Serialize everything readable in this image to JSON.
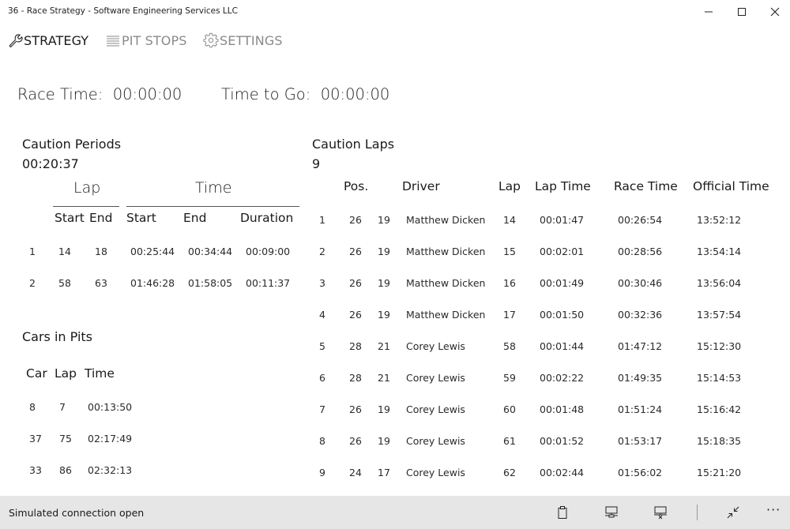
{
  "app": {
    "title": "36 - Race Strategy - Software Engineering Services LLC"
  },
  "nav": {
    "strategy": "STRATEGY",
    "pit_stops": "PIT STOPS",
    "settings": "SETTINGS"
  },
  "race": {
    "race_time_label": "Race Time:",
    "race_time_value": "00:00:00",
    "time_to_go_label": "Time to Go:",
    "time_to_go_value": "00:00:00"
  },
  "caution_periods": {
    "title": "Caution Periods",
    "total": "00:20:37",
    "group_lap": "Lap",
    "group_time": "Time",
    "headers": [
      "Start",
      "End",
      "Start",
      "End",
      "Duration"
    ],
    "rows": [
      [
        "1",
        "14",
        "18",
        "00:25:44",
        "00:34:44",
        "00:09:00"
      ],
      [
        "2",
        "58",
        "63",
        "01:46:28",
        "01:58:05",
        "00:11:37"
      ]
    ]
  },
  "cars_in_pits": {
    "title": "Cars in Pits",
    "headers": [
      "Car",
      "Lap",
      "Time"
    ],
    "rows": [
      [
        "8",
        "7",
        "00:13:50"
      ],
      [
        "37",
        "75",
        "02:17:49"
      ],
      [
        "33",
        "86",
        "02:32:13"
      ]
    ]
  },
  "caution_laps": {
    "title": "Caution Laps",
    "count": "9",
    "headers": [
      "Pos.",
      "Driver",
      "Lap",
      "Lap Time",
      "Race Time",
      "Official Time"
    ],
    "rows": [
      [
        "1",
        "26",
        "19",
        "Matthew Dicken",
        "14",
        "00:01:47",
        "00:26:54",
        "13:52:12"
      ],
      [
        "2",
        "26",
        "19",
        "Matthew Dicken",
        "15",
        "00:02:01",
        "00:28:56",
        "13:54:14"
      ],
      [
        "3",
        "26",
        "19",
        "Matthew Dicken",
        "16",
        "00:01:49",
        "00:30:46",
        "13:56:04"
      ],
      [
        "4",
        "26",
        "19",
        "Matthew Dicken",
        "17",
        "00:01:50",
        "00:32:36",
        "13:57:54"
      ],
      [
        "5",
        "28",
        "21",
        "Corey Lewis",
        "58",
        "00:01:44",
        "01:47:12",
        "15:12:30"
      ],
      [
        "6",
        "28",
        "21",
        "Corey Lewis",
        "59",
        "00:02:22",
        "01:49:35",
        "15:14:53"
      ],
      [
        "7",
        "26",
        "19",
        "Corey Lewis",
        "60",
        "00:01:48",
        "01:51:24",
        "15:16:42"
      ],
      [
        "8",
        "26",
        "19",
        "Corey Lewis",
        "61",
        "00:01:52",
        "01:53:17",
        "15:18:35"
      ],
      [
        "9",
        "24",
        "17",
        "Corey Lewis",
        "62",
        "00:02:44",
        "01:56:02",
        "15:21:20"
      ]
    ]
  },
  "status": {
    "text": "Simulated connection open",
    "more": "···"
  }
}
